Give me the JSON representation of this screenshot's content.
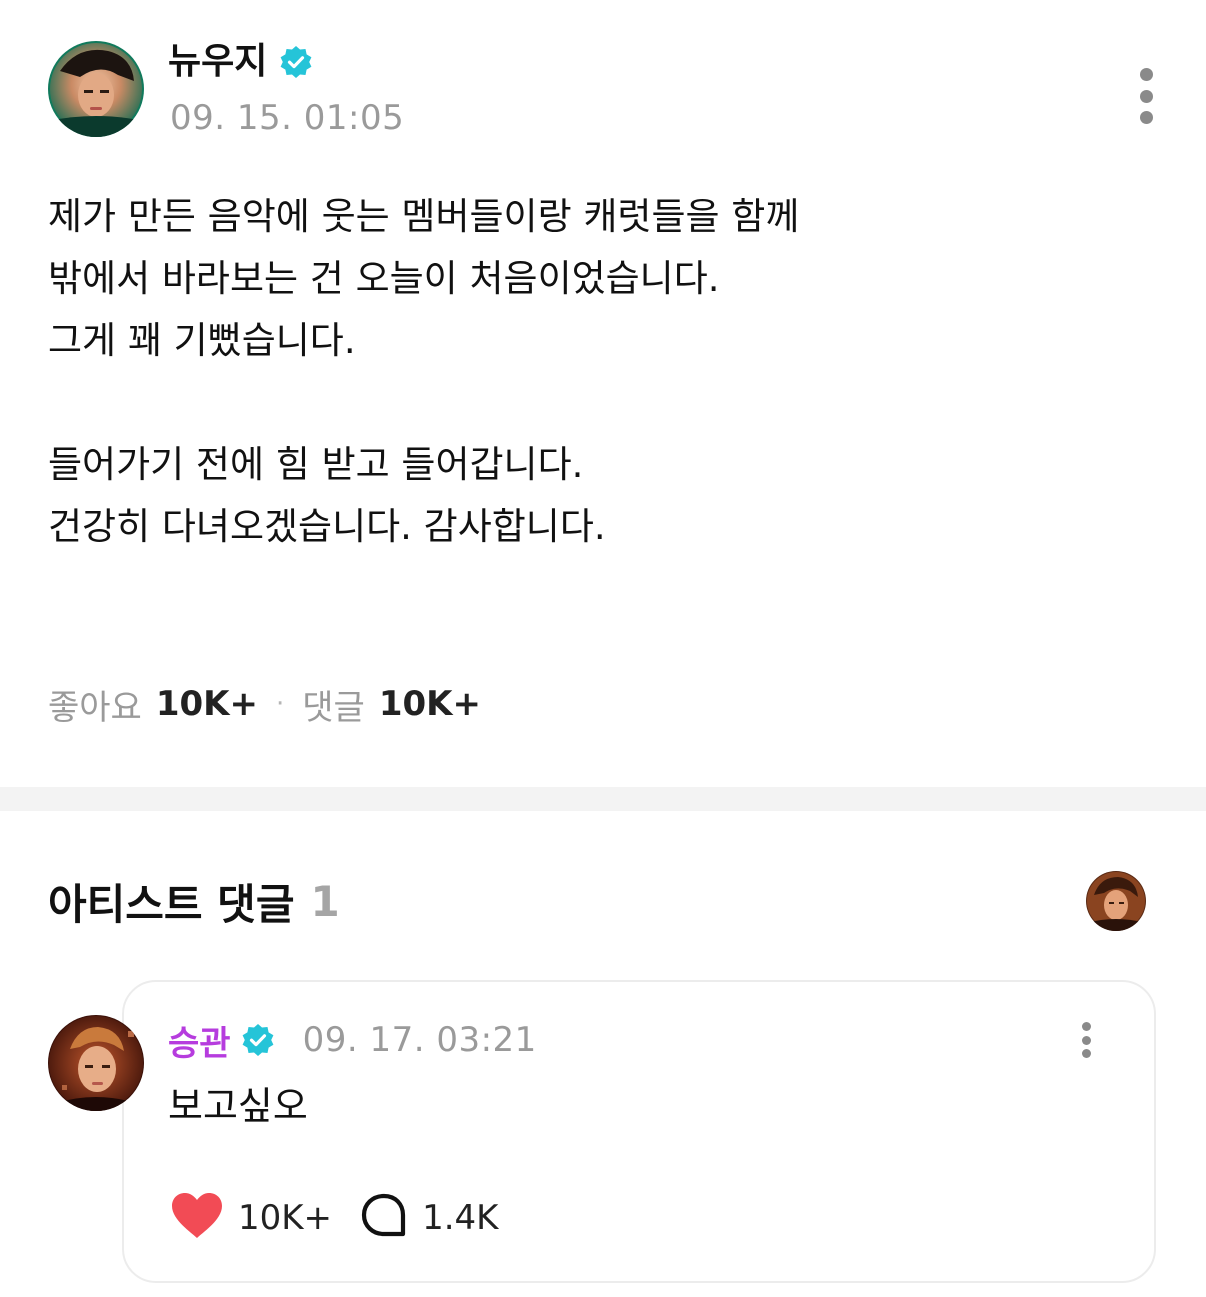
{
  "post": {
    "author": {
      "name": "뉴우지",
      "verified": true,
      "avatar": "avatar-image"
    },
    "date": "09. 15. 01:05",
    "more_icon": "more-vertical-icon",
    "body_lines": [
      "제가 만든 음악에 웃는 멤버들이랑 캐럿들을 함께",
      "밖에서 바라보는 건 오늘이 처음이었습니다.",
      "그게 꽤 기뻤습니다.",
      "",
      "들어가기 전에 힘 받고 들어갑니다.",
      "건강히 다녀오겠습니다. 감사합니다."
    ],
    "stats": {
      "likes_label": "좋아요",
      "likes_value": "10K+",
      "separator": "·",
      "comments_label": "댓글",
      "comments_value": "10K+"
    }
  },
  "artist_comments": {
    "title": "아티스트 댓글",
    "count": "1",
    "comment": {
      "author": "승관",
      "verified": true,
      "date": "09. 17. 03:21",
      "text": "보고싶오",
      "likes": "10K+",
      "replies": "1.4K",
      "like_icon": "heart-icon",
      "reply_icon": "speech-bubble-icon",
      "more_icon": "more-vertical-icon"
    }
  },
  "colors": {
    "verified": "#25c4d8",
    "comment_author": "#b63cde",
    "heart": "#f24b55",
    "muted": "#9a9a9a",
    "band": "#f3f3f3"
  }
}
